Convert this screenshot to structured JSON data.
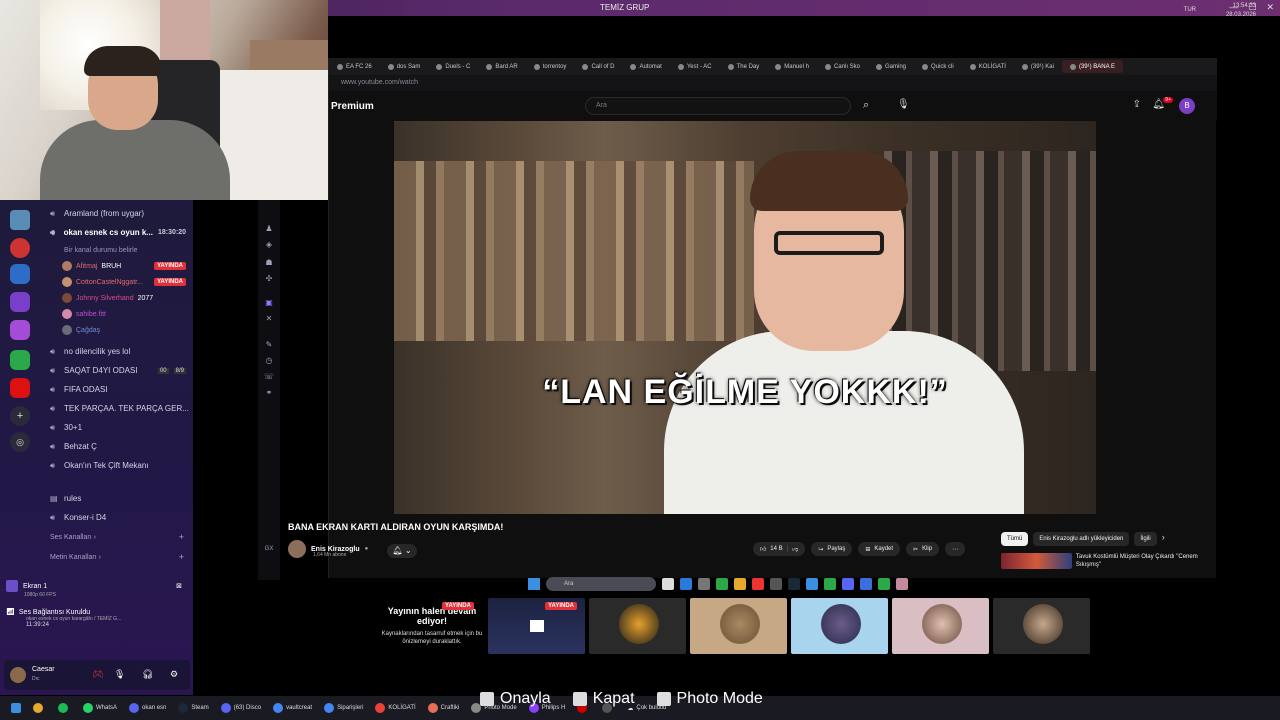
{
  "top_bar": {
    "title": "TEMİZ GRUP"
  },
  "discord": {
    "channels_top": [
      {
        "name": "Aramland (from uygar)"
      }
    ],
    "active_channel": {
      "name": "okan esnek cs oyun k...",
      "time": "18:30:20",
      "status": "Bir kanal durumu belirle"
    },
    "members": [
      {
        "name": "Afitmaj",
        "tag": "BRUH",
        "color": "#e06b6b"
      },
      {
        "name": "CottonCastelNggatr...",
        "live": "YAYINDA",
        "color": "#e46a6a"
      },
      {
        "name": "Johnny Silverhand",
        "tag": "2077",
        "color": "#d94d8a"
      },
      {
        "name": "sahibe.fitt",
        "color": "#c24fd0"
      },
      {
        "name": "Çağdaş",
        "color": "#6f8bd6"
      }
    ],
    "active_live": "YAYINDA",
    "channels": [
      {
        "name": "no dilencilik yes lol"
      },
      {
        "name": "SAQAT D4YI ODASI",
        "badge_a": "00",
        "badge_b": "8/9"
      },
      {
        "name": "FIFA ODASI"
      },
      {
        "name": "TEK PARÇAA. TEK PARÇA GER..."
      },
      {
        "name": "30+1"
      },
      {
        "name": "Behzat Ç"
      },
      {
        "name": "Okan'ın Tek Çift Mekanı"
      }
    ],
    "text_channels": [
      {
        "name": "rules"
      },
      {
        "name": "Konser-i D4"
      }
    ],
    "sections": {
      "voice": "Ses Kanalları",
      "text": "Metin Kanalları"
    },
    "screen": {
      "title": "Ekran 1",
      "sub": "1080p 60 FPS"
    },
    "voice_status": {
      "title": "Ses Bağlantısı Kuruldu",
      "sub": "okan esnek cs oyun karargâhı / TEMİZ G...",
      "time": "11:39:24"
    },
    "user": {
      "name": "Caesar",
      "status": "Dıc"
    }
  },
  "browser": {
    "tabs": [
      {
        "label": "EA FC 26"
      },
      {
        "label": "dos Sam"
      },
      {
        "label": "Duels - C"
      },
      {
        "label": "Bard AR"
      },
      {
        "label": "torrentoy"
      },
      {
        "label": "Call of D"
      },
      {
        "label": "Automat"
      },
      {
        "label": "Yest - AC"
      },
      {
        "label": "The Day"
      },
      {
        "label": "Manuel h"
      },
      {
        "label": "Canlı Sko"
      },
      {
        "label": "Gaming"
      },
      {
        "label": "Quick cli"
      },
      {
        "label": "KOLİGATİ"
      },
      {
        "label": "(39¹) Kai"
      },
      {
        "label": "(39¹) BANA E",
        "active": true
      }
    ],
    "url": "www.youtube.com/watch"
  },
  "youtube": {
    "logo": "Premium",
    "search_placeholder": "Ara",
    "notif_count": "9+",
    "avatar_letter": "B",
    "subtitle": "“LAN EĞİLME YOKKK!”",
    "video_title": "BANA EKRAN KARTI ALDIRAN OYUN KARŞIMDA!",
    "channel_name": "Enis Kirazoglu",
    "subscribers": "1,64 Mn abone",
    "like_count": "14 B",
    "share_label": "Paylaş",
    "save_label": "Kaydet",
    "clip_label": "Klip",
    "chips": [
      "Tümü",
      "Enis Kirazoglu adlı yükleyiciden",
      "İlgili"
    ],
    "rec_title": "Tavuk Kostümlü Müşteri Olay Çıkardı \"Cenem Sıkışmış\""
  },
  "inner_taskbar": {
    "search_placeholder": "Ara"
  },
  "alt_tab": {
    "live": "YAYINDA",
    "message_big": "Yayının halen devam ediyor!",
    "message_small": "Kaynaklarından tasarruf etmek için bu önizlemeyi duraklattık."
  },
  "taskbar": {
    "items": [
      {
        "label": "",
        "color": "#e5a92b"
      },
      {
        "label": "",
        "color": "#1db954"
      },
      {
        "label": "WhatsA",
        "color": "#25d366"
      },
      {
        "label": "okan esn",
        "color": "#5865f2"
      },
      {
        "label": "Steam",
        "color": "#1b2838"
      },
      {
        "label": "(63) Disco",
        "color": "#5865f2"
      },
      {
        "label": "vaultcreat",
        "color": "#4285f4"
      },
      {
        "label": "Siparişleri",
        "color": "#4285f4"
      },
      {
        "label": "KOLİGATİ",
        "color": "#ea4335"
      },
      {
        "label": "Craftiki",
        "color": "#e76f51"
      },
      {
        "label": "Photo Mode",
        "color": "#888"
      },
      {
        "label": "Philips H",
        "color": "#8a3ffc"
      },
      {
        "label": "",
        "color": "#c00"
      },
      {
        "label": "",
        "color": "#555"
      }
    ],
    "weather": "Çok bulutlu",
    "lang": "TUR",
    "time": "13:54:33",
    "date": "28.03.2026"
  },
  "hints": {
    "confirm": "Onayla",
    "close": "Kapat",
    "photo": "Photo Mode"
  }
}
